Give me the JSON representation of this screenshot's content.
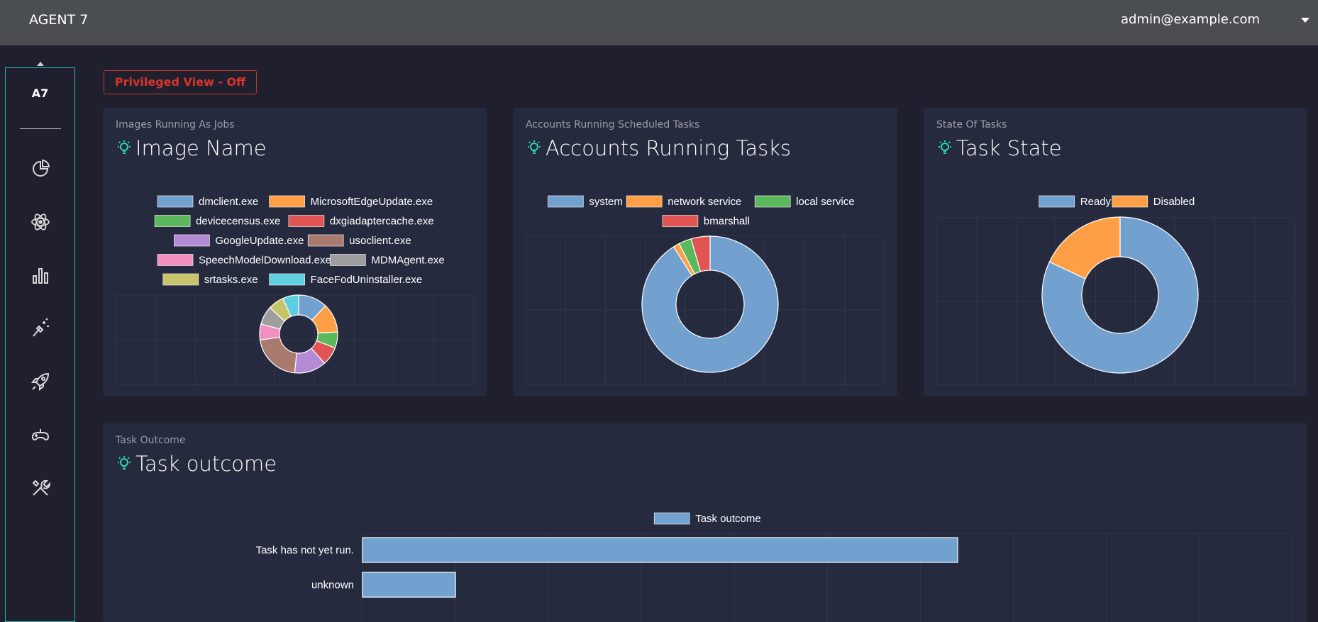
{
  "header": {
    "brand": "AGENT 7",
    "user_email": "admin@example.com"
  },
  "sidebar": {
    "logo": "A7",
    "items": [
      {
        "name": "pie-chart-icon"
      },
      {
        "name": "atom-icon"
      },
      {
        "name": "bar-chart-icon"
      },
      {
        "name": "magic-wand-icon"
      },
      {
        "name": "rocket-icon"
      },
      {
        "name": "gamepad-icon"
      },
      {
        "name": "tools-icon"
      }
    ]
  },
  "privileged_view": {
    "label": "Privileged View - Off",
    "color": "#d9342b"
  },
  "colors": {
    "blue": "#72a0cf",
    "orange": "#ff9f45",
    "green": "#5cb85c",
    "red": "#e05454",
    "purple": "#b48ad4",
    "brown": "#a97b6f",
    "pink": "#f08fc0",
    "gray": "#9e9e9e",
    "olive": "#c8c46a",
    "cyan": "#5ecfe0",
    "accent": "#2bd4b2"
  },
  "cards": {
    "images": {
      "subtitle": "Images Running As Jobs",
      "title": "Image Name"
    },
    "accounts": {
      "subtitle": "Accounts Running Scheduled Tasks",
      "title": "Accounts Running Tasks"
    },
    "state": {
      "subtitle": "State Of Tasks",
      "title": "Task State"
    },
    "outcome": {
      "subtitle": "Task Outcome",
      "title": "Task outcome"
    }
  },
  "chart_data": [
    {
      "type": "pie",
      "variant": "doughnut",
      "labels": [
        "dmclient.exe",
        "MicrosoftEdgeUpdate.exe",
        "devicecensus.exe",
        "dxgiadaptercache.exe",
        "GoogleUpdate.exe",
        "usoclient.exe",
        "SpeechModelDownload.exe",
        "MDMAgent.exe",
        "srtasks.exe",
        "FaceFodUninstaller.exe"
      ],
      "values": [
        11,
        11,
        6,
        7,
        12,
        19,
        6,
        7,
        6,
        6
      ],
      "colors": [
        "#72a0cf",
        "#ff9f45",
        "#5cb85c",
        "#e05454",
        "#b48ad4",
        "#a97b6f",
        "#f08fc0",
        "#9e9e9e",
        "#c8c46a",
        "#5ecfe0"
      ],
      "legend": "top"
    },
    {
      "type": "pie",
      "variant": "doughnut",
      "labels": [
        "system",
        "network service",
        "local service",
        "bmarshall"
      ],
      "values": [
        91,
        1.5,
        3,
        4.5
      ],
      "colors": [
        "#72a0cf",
        "#ff9f45",
        "#5cb85c",
        "#e05454"
      ],
      "legend": "top"
    },
    {
      "type": "pie",
      "variant": "doughnut",
      "labels": [
        "Ready",
        "Disabled"
      ],
      "values": [
        82,
        18
      ],
      "colors": [
        "#72a0cf",
        "#ff9f45"
      ],
      "legend": "top"
    },
    {
      "type": "bar",
      "orientation": "horizontal",
      "categories": [
        "Task has not yet run.",
        "unknown"
      ],
      "series": [
        {
          "name": "Task outcome",
          "values": [
            32,
            5
          ]
        }
      ],
      "xlim": [
        0,
        50
      ],
      "color": "#72a0cf",
      "legend": "top"
    }
  ]
}
